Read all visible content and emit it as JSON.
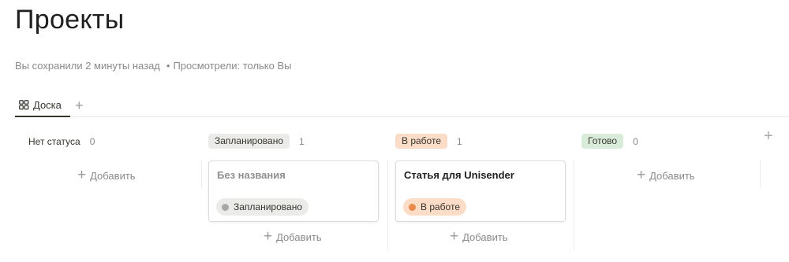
{
  "page": {
    "title": "Проекты",
    "saved": "Вы сохранили 2 минуты назад",
    "separator": "•",
    "viewed": "Просмотрели: только Вы"
  },
  "tabs": [
    {
      "label": "Доска",
      "icon": "board-icon",
      "active": true
    }
  ],
  "tab_add_label": "+",
  "add_column_label": "+",
  "columns": [
    {
      "label": "Нет статуса",
      "count": "0",
      "pill_color": null,
      "add_label": "Добавить",
      "cards": []
    },
    {
      "label": "Запланировано",
      "count": "1",
      "pill_color": "#ebebea",
      "add_label": "Добавить",
      "cards": [
        {
          "title": "Без названия",
          "title_color": "#8f8f8f",
          "status": "Запланировано",
          "status_bg": "#ebebea",
          "dot_color": "#a8a8a8"
        }
      ]
    },
    {
      "label": "В работе",
      "count": "1",
      "pill_color": "#fbdcc7",
      "add_label": "Добавить",
      "cards": [
        {
          "title": "Статья для Unisender",
          "title_color": "#1f1f1f",
          "status": "В работе",
          "status_bg": "#fbdcc7",
          "dot_color": "#ea8a4c"
        }
      ]
    },
    {
      "label": "Готово",
      "count": "0",
      "pill_color": "#d9ecd9",
      "add_label": "Добавить",
      "cards": []
    }
  ]
}
